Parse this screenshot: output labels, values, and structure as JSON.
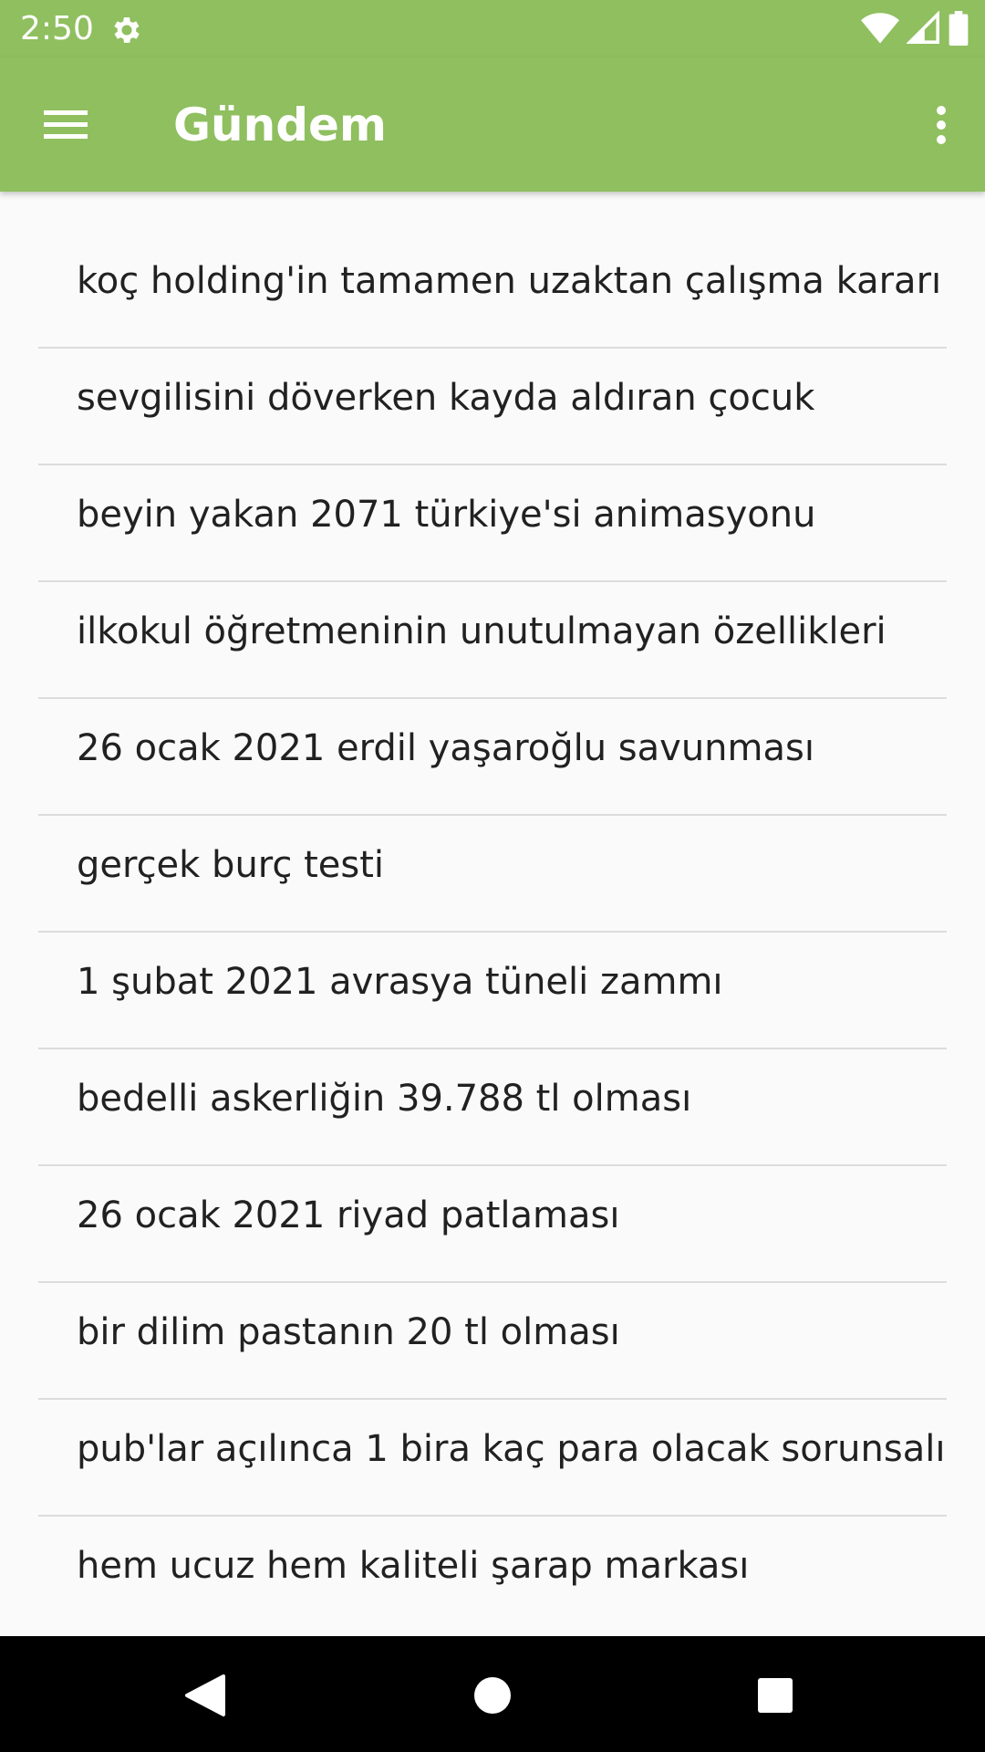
{
  "status_bar": {
    "time": "2:50",
    "icons": [
      "settings-gear-icon",
      "wifi-icon",
      "cell-signal-icon",
      "battery-icon"
    ]
  },
  "app_bar": {
    "title": "Gündem",
    "menu_icon": "hamburger-menu-icon",
    "overflow_icon": "more-vert-icon",
    "color": "#8fbf5f"
  },
  "topics": [
    "koç holding'in tamamen uzaktan çalışma kararı",
    "sevgilisini döverken kayda aldıran çocuk",
    "beyin yakan 2071 türkiye'si animasyonu",
    "ilkokul öğretmeninin unutulmayan özellikleri",
    "26 ocak 2021 erdil yaşaroğlu savunması",
    "gerçek burç testi",
    "1 şubat 2021 avrasya tüneli zammı",
    "bedelli askerliğin 39.788 tl olması",
    "26 ocak 2021 riyad patlaması",
    "bir dilim pastanın 20 tl olması",
    "pub'lar açılınca 1 bira kaç para olacak sorunsalı",
    "hem ucuz hem kaliteli şarap markası"
  ],
  "nav_bar": {
    "back_icon": "back-triangle-icon",
    "home_icon": "home-circle-icon",
    "recents_icon": "recents-square-icon"
  }
}
